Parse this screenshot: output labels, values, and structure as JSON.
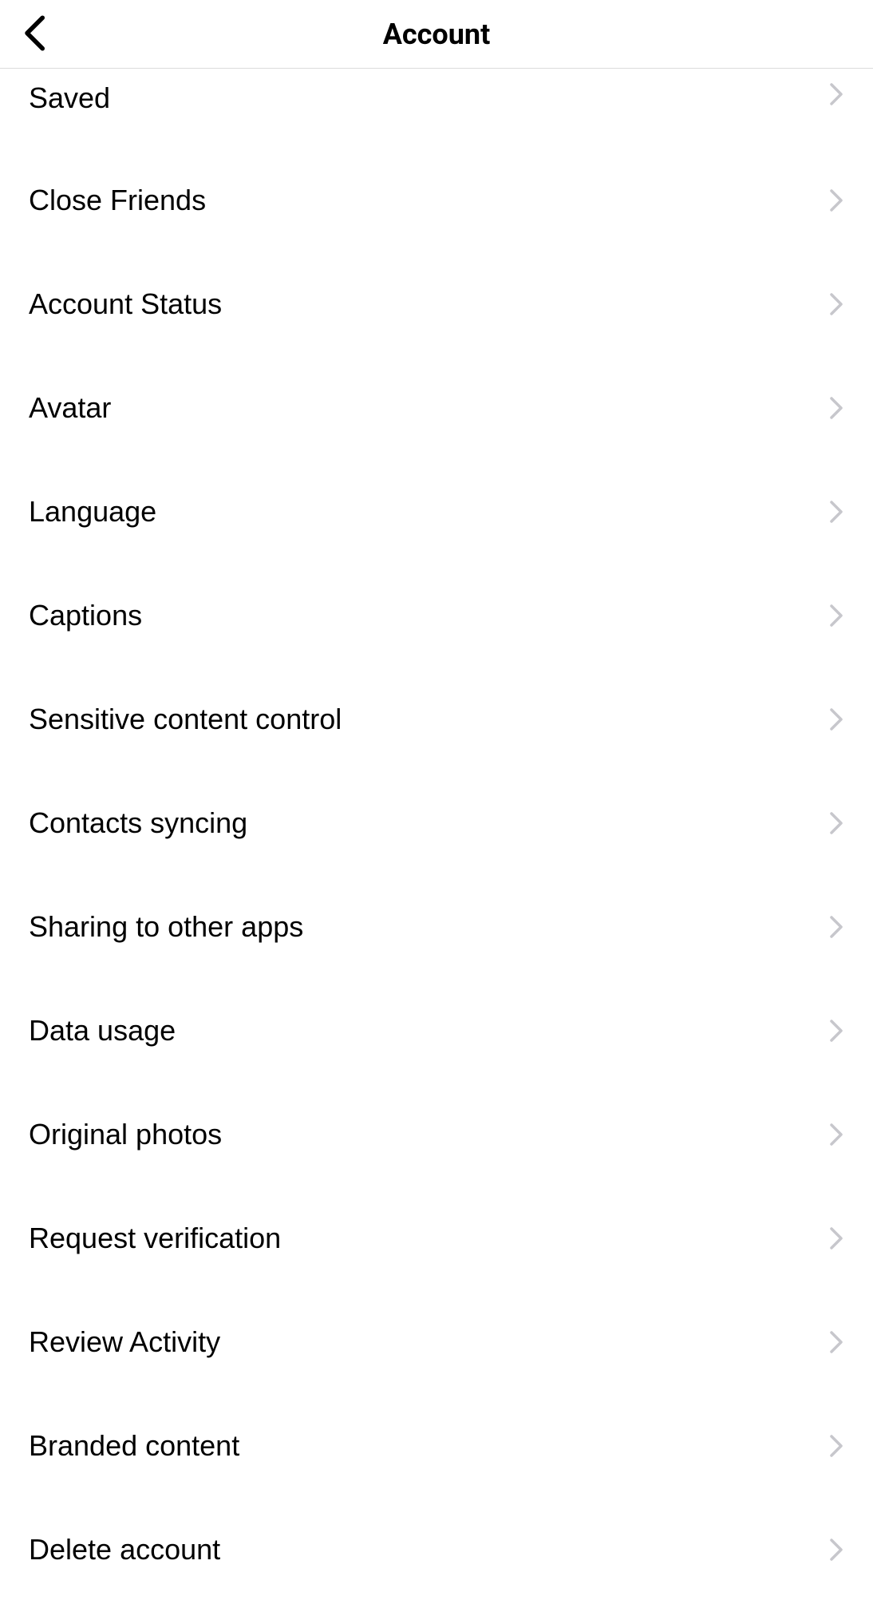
{
  "header": {
    "title": "Account"
  },
  "menu": {
    "items": [
      {
        "label": "Saved"
      },
      {
        "label": "Close Friends"
      },
      {
        "label": "Account Status"
      },
      {
        "label": "Avatar"
      },
      {
        "label": "Language"
      },
      {
        "label": "Captions"
      },
      {
        "label": "Sensitive content control"
      },
      {
        "label": "Contacts syncing"
      },
      {
        "label": "Sharing to other apps"
      },
      {
        "label": "Data usage"
      },
      {
        "label": "Original photos"
      },
      {
        "label": "Request verification"
      },
      {
        "label": "Review Activity"
      },
      {
        "label": "Branded content"
      },
      {
        "label": "Delete account"
      }
    ]
  }
}
